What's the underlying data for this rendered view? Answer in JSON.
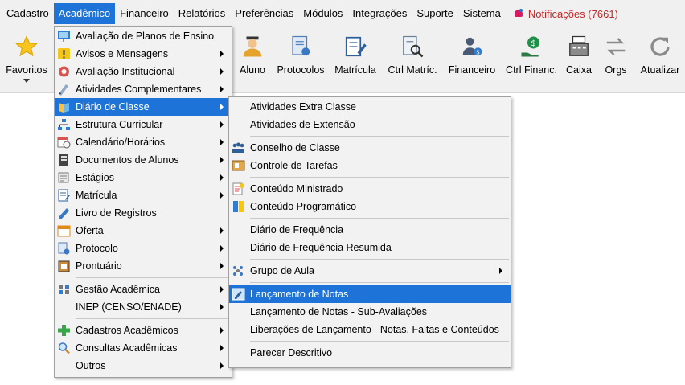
{
  "menubar": {
    "items": [
      "Cadastro",
      "Acadêmico",
      "Financeiro",
      "Relatórios",
      "Preferências",
      "Módulos",
      "Integrações",
      "Suporte",
      "Sistema"
    ],
    "notifications": "Notificações (7661)",
    "notif_color": "#c62828"
  },
  "toolbar": {
    "favoritos": "Favoritos",
    "aluno": "Aluno",
    "protocolos": "Protocolos",
    "matricula": "Matrícula",
    "ctrl_matric": "Ctrl Matríc.",
    "financeiro": "Financeiro",
    "ctrl_financ": "Ctrl Financ.",
    "caixa": "Caixa",
    "orgs": "Orgs",
    "atualizar": "Atualizar"
  },
  "academico_menu": {
    "items": [
      "Avaliação de Planos de Ensino",
      "Avisos e Mensagens",
      "Avaliação Institucional",
      "Atividades Complementares",
      "Diário de Classe",
      "Estrutura Curricular",
      "Calendário/Horários",
      "Documentos de Alunos",
      "Estágios",
      "Matrícula",
      "Livro de Registros",
      "Oferta",
      "Protocolo",
      "Prontuário",
      "Gestão Acadêmica",
      "INEP (CENSO/ENADE)",
      "Cadastros Acadêmicos",
      "Consultas Acadêmicas",
      "Outros"
    ]
  },
  "diario_menu": {
    "items": [
      "Atividades Extra Classe",
      "Atividades de Extensão",
      "Conselho de Classe",
      "Controle de Tarefas",
      "Conteúdo Ministrado",
      "Conteúdo Programático",
      "Diário de Frequência",
      "Diário de Frequência Resumida",
      "Grupo de Aula",
      "Lançamento de Notas",
      "Lançamento de Notas - Sub-Avaliações",
      "Liberações de Lançamento - Notas, Faltas e Conteúdos",
      "Parecer Descritivo"
    ]
  },
  "colors": {
    "highlight": "#1e73d9",
    "menu_bg": "#f2f2f2",
    "bar_bg": "#f0f0f0"
  }
}
